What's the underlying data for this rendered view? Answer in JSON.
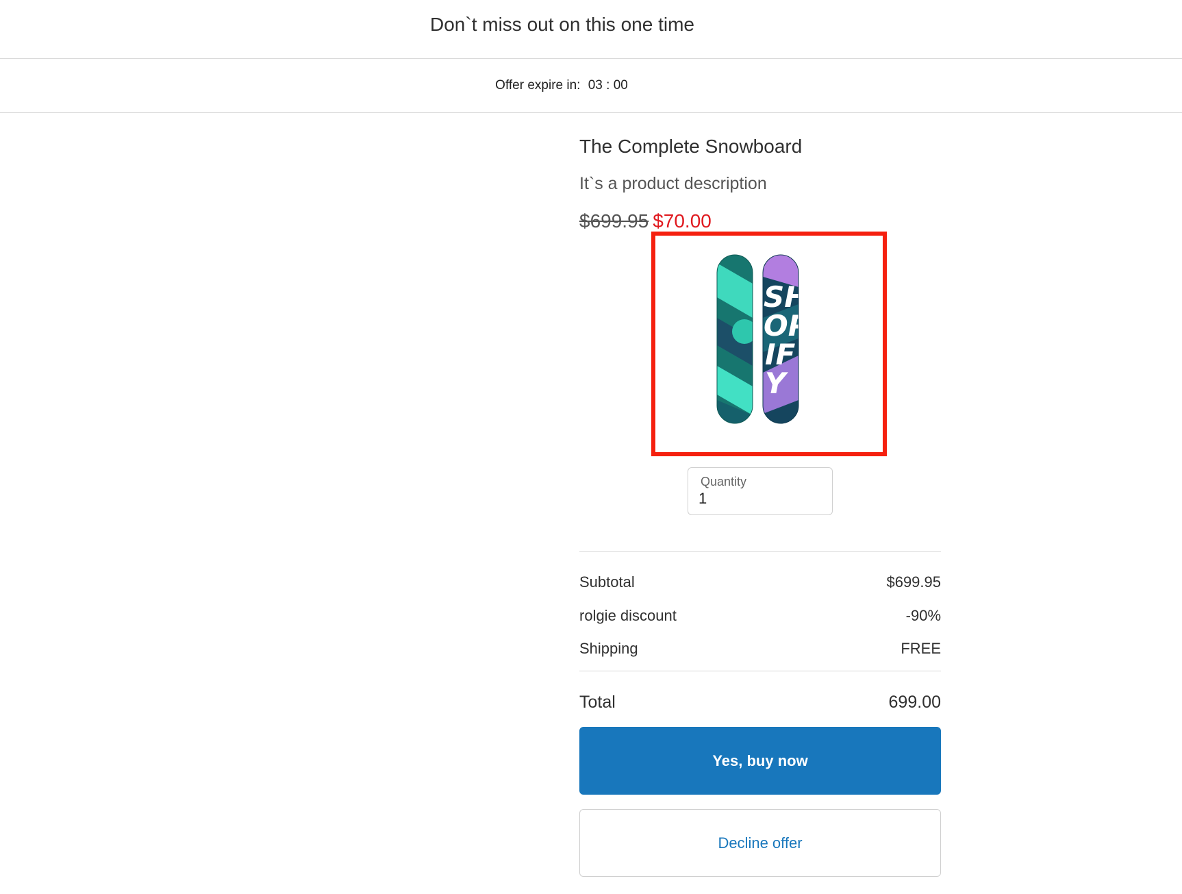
{
  "header": {
    "title": "Don`t miss out on this one time"
  },
  "timer": {
    "label": "Offer expire in:",
    "value": "03 : 00"
  },
  "product": {
    "title": "The Complete Snowboard",
    "description": "It`s a product description",
    "original_price": "$699.95",
    "sale_price": "$70.00",
    "image_icon": "snowboard-product-image",
    "image_text": "SHOPIFY",
    "highlight_color": "#f5200f"
  },
  "quantity": {
    "label": "Quantity",
    "value": "1"
  },
  "summary": {
    "subtotal_label": "Subtotal",
    "subtotal_value": "$699.95",
    "discount_label": "rolgie discount",
    "discount_value": "-90%",
    "shipping_label": "Shipping",
    "shipping_value": "FREE",
    "total_label": "Total",
    "total_value": "699.00"
  },
  "actions": {
    "buy_label": "Yes, buy now",
    "decline_label": "Decline offer",
    "accent_color": "#1877bc"
  },
  "colors": {
    "sale_price": "#e0191f",
    "divider": "#d9d9d9"
  }
}
